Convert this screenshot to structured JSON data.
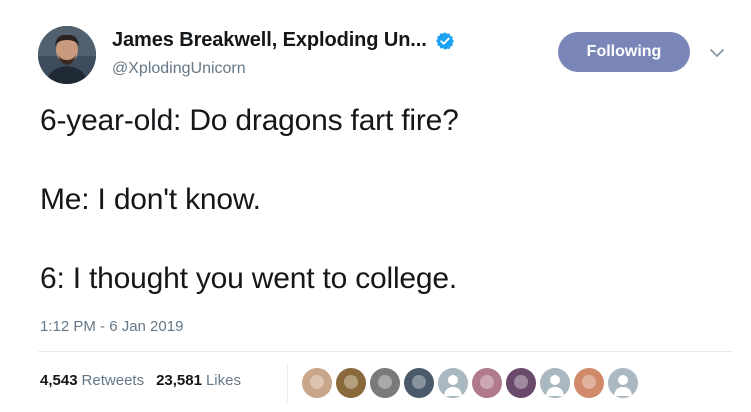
{
  "tweet": {
    "author": {
      "display_name": "James Breakwell, Exploding Un...",
      "handle": "@XplodingUnicorn",
      "verified": true,
      "avatar_icon": "profile-photo"
    },
    "follow_button_label": "Following",
    "menu_icon": "chevron-down-icon",
    "lines": [
      "6-year-old: Do dragons fart fire?",
      "Me: I don't know.",
      "6: I thought you went to college."
    ],
    "timestamp": "1:12 PM - 6 Jan 2019",
    "stats": {
      "retweets_count": "4,543",
      "retweets_label": "Retweets",
      "likes_count": "23,581",
      "likes_label": "Likes"
    },
    "likers": [
      {
        "name": "liker-avatar-1",
        "color": "#c9a58a"
      },
      {
        "name": "liker-avatar-2",
        "color": "#8a6a3a"
      },
      {
        "name": "liker-avatar-3",
        "color": "#7a7a7a"
      },
      {
        "name": "liker-avatar-4",
        "color": "#4a5a6a"
      },
      {
        "name": "liker-avatar-5",
        "color": "#aab8c2"
      },
      {
        "name": "liker-avatar-6",
        "color": "#b07a8a"
      },
      {
        "name": "liker-avatar-7",
        "color": "#6a4a6a"
      },
      {
        "name": "liker-avatar-8",
        "color": "#aab8c2"
      },
      {
        "name": "liker-avatar-9",
        "color": "#d08a6a"
      },
      {
        "name": "liker-avatar-10",
        "color": "#aab8c2"
      }
    ]
  },
  "colors": {
    "accent": "#1da1f2",
    "follow_button_bg": "#7a86b8",
    "secondary_text": "#657786",
    "primary_text": "#14171a"
  }
}
